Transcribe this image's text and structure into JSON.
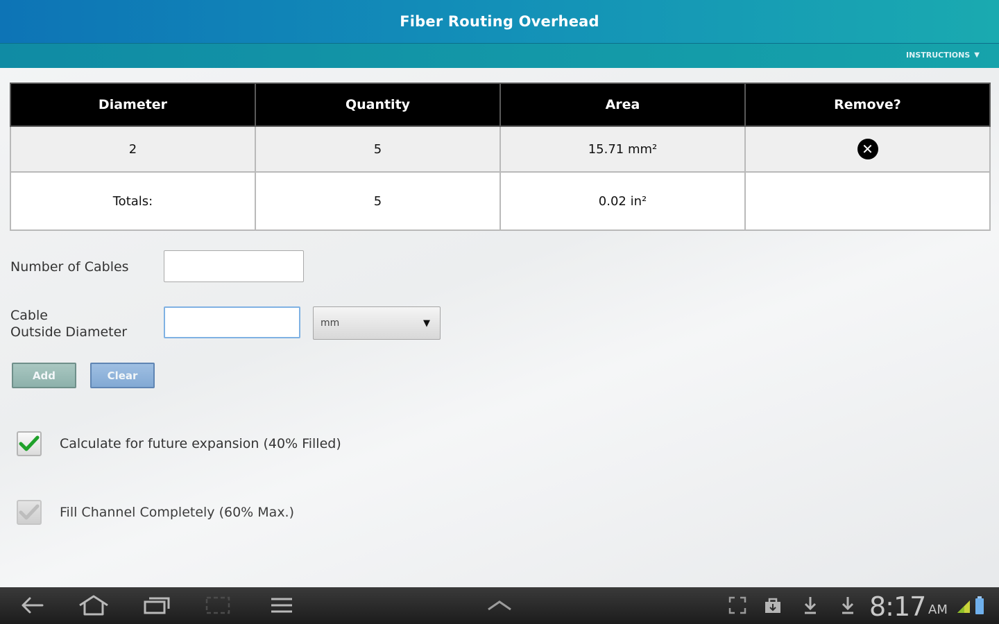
{
  "header": {
    "title": "Fiber Routing Overhead",
    "instructions_label": "INSTRUCTIONS",
    "instructions_caret": "▼"
  },
  "table": {
    "columns": [
      "Diameter",
      "Quantity",
      "Area",
      "Remove?"
    ],
    "rows": [
      {
        "diameter": "2",
        "quantity": "5",
        "area": "15.71 mm²",
        "remove_icon": "✕"
      }
    ],
    "totals": {
      "label": "Totals:",
      "quantity": "5",
      "area": "0.02 in²"
    }
  },
  "form": {
    "num_cables_label": "Number of Cables",
    "num_cables_value": "",
    "diameter_label_line1": "Cable",
    "diameter_label_line2": "Outside Diameter",
    "diameter_value": "",
    "unit_selected": "mm",
    "add_label": "Add",
    "clear_label": "Clear"
  },
  "options": {
    "future_expansion": {
      "label": "Calculate for future expansion (40% Filled)",
      "checked": true
    },
    "fill_channel": {
      "label": "Fill Channel Completely (60% Max.)",
      "checked": true,
      "disabled": true
    }
  },
  "statusbar": {
    "time": "8:17",
    "ampm": "AM"
  },
  "colors": {
    "title_bar": "#0d74b6",
    "accent_teal": "#16a3ab",
    "check_green": "#1fa12a",
    "add_button": "#8db1ab",
    "clear_button": "#82a9d4"
  }
}
